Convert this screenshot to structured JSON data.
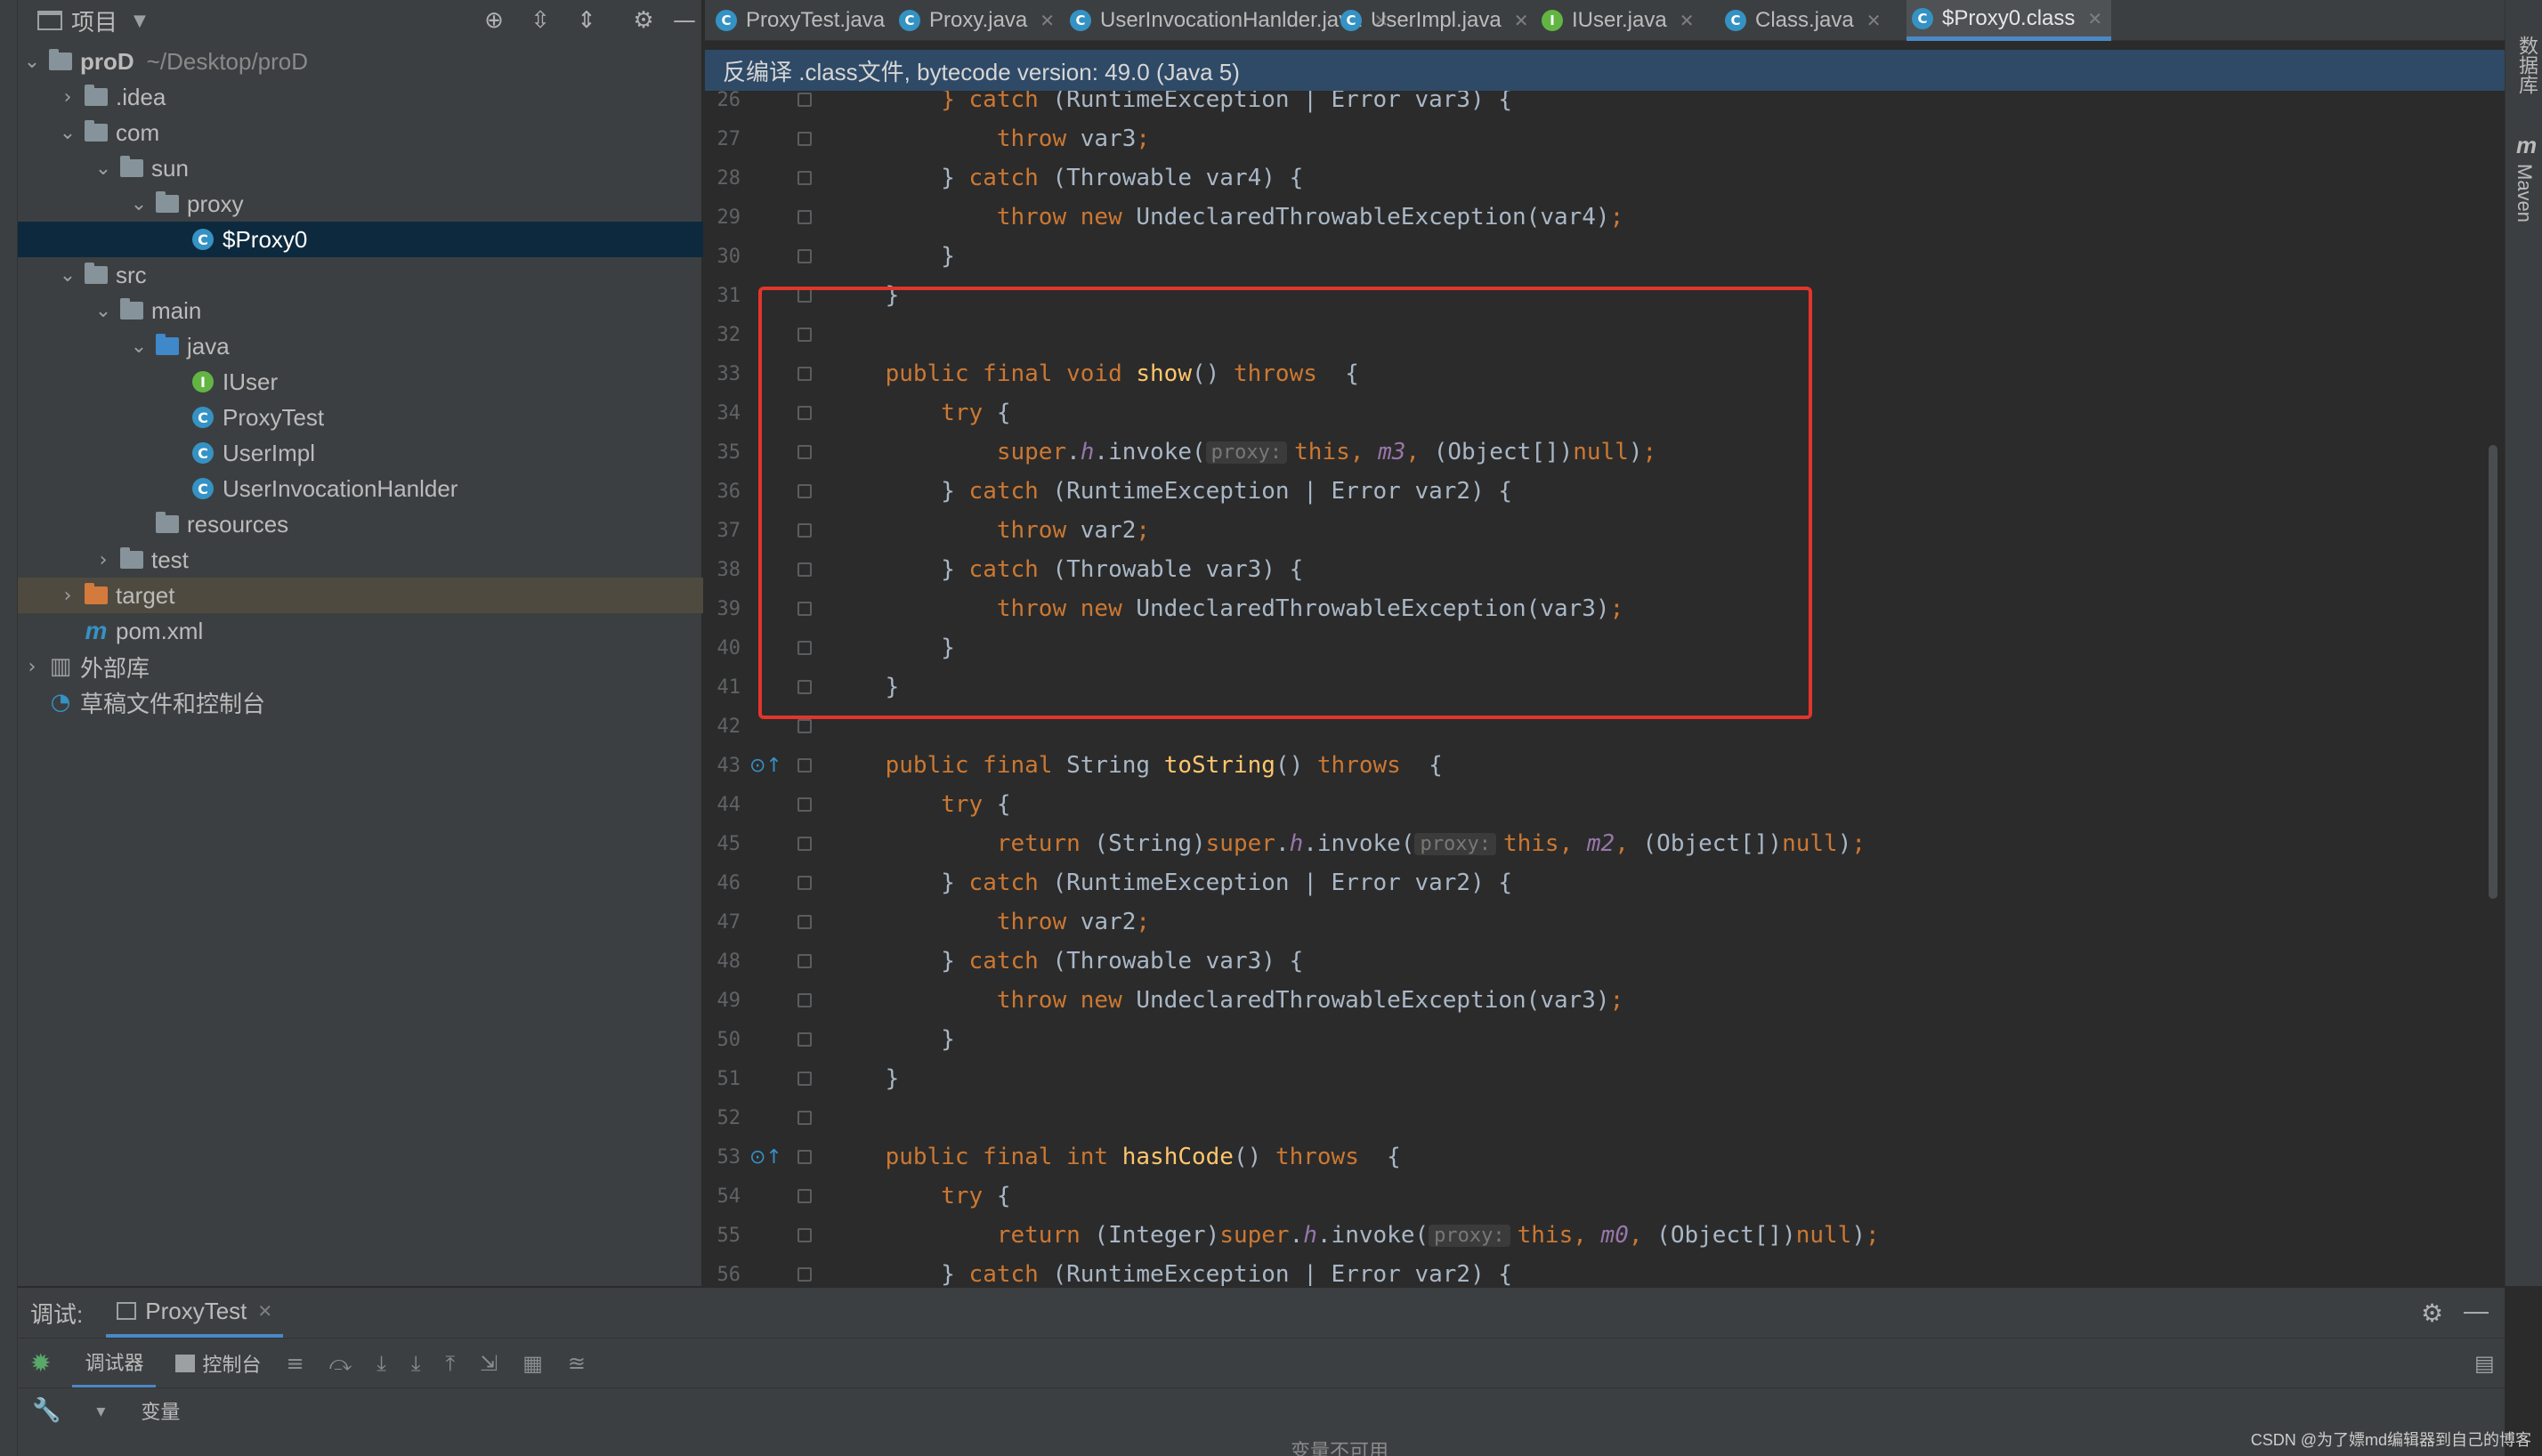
{
  "project": {
    "title": "项目",
    "tree": [
      {
        "label": "proD",
        "extra": "~/Desktop/proD",
        "depth": 0,
        "arrow": "down",
        "icon": "folder",
        "bold": true
      },
      {
        "label": ".idea",
        "depth": 1,
        "arrow": "right",
        "icon": "folder"
      },
      {
        "label": "com",
        "depth": 1,
        "arrow": "down",
        "icon": "folder"
      },
      {
        "label": "sun",
        "depth": 2,
        "arrow": "down",
        "icon": "folder"
      },
      {
        "label": "proxy",
        "depth": 3,
        "arrow": "down",
        "icon": "folder"
      },
      {
        "label": "$Proxy0",
        "depth": 4,
        "arrow": "",
        "icon": "class",
        "selected": true
      },
      {
        "label": "src",
        "depth": 1,
        "arrow": "down",
        "icon": "folder"
      },
      {
        "label": "main",
        "depth": 2,
        "arrow": "down",
        "icon": "folder"
      },
      {
        "label": "java",
        "depth": 3,
        "arrow": "down",
        "icon": "folder-blue"
      },
      {
        "label": "IUser",
        "depth": 4,
        "arrow": "",
        "icon": "interface"
      },
      {
        "label": "ProxyTest",
        "depth": 4,
        "arrow": "",
        "icon": "class"
      },
      {
        "label": "UserImpl",
        "depth": 4,
        "arrow": "",
        "icon": "class"
      },
      {
        "label": "UserInvocationHanlder",
        "depth": 4,
        "arrow": "",
        "icon": "class"
      },
      {
        "label": "resources",
        "depth": 3,
        "arrow": "",
        "icon": "folder-res"
      },
      {
        "label": "test",
        "depth": 2,
        "arrow": "right",
        "icon": "folder"
      },
      {
        "label": "target",
        "depth": 1,
        "arrow": "right",
        "icon": "folder-orange",
        "highlight": true
      },
      {
        "label": "pom.xml",
        "depth": 1,
        "arrow": "",
        "icon": "maven"
      },
      {
        "label": "外部库",
        "depth": 0,
        "arrow": "right",
        "icon": "library"
      },
      {
        "label": "草稿文件和控制台",
        "depth": 0,
        "arrow": "",
        "icon": "scratch"
      }
    ]
  },
  "tabs": [
    {
      "label": "ProxyTest.java",
      "icon": "class"
    },
    {
      "label": "Proxy.java",
      "icon": "class"
    },
    {
      "label": "UserInvocationHanlder.java",
      "icon": "class"
    },
    {
      "label": "UserImpl.java",
      "icon": "class"
    },
    {
      "label": "IUser.java",
      "icon": "interface"
    },
    {
      "label": "Class.java",
      "icon": "class"
    },
    {
      "label": "$Proxy0.class",
      "icon": "class",
      "active": true
    }
  ],
  "banner": "反编译 .class文件, bytecode version: 49.0 (Java 5)",
  "code": [
    {
      "n": "26",
      "t": [
        [
          "kw",
          "        } catch "
        ],
        [
          "tx",
          "(RuntimeException | Error var3) {"
        ]
      ]
    },
    {
      "n": "27",
      "t": [
        [
          "kw",
          "            throw "
        ],
        [
          "tx",
          "var3"
        ],
        [
          "kw",
          ";"
        ]
      ]
    },
    {
      "n": "28",
      "t": [
        [
          "tx",
          "        } "
        ],
        [
          "kw",
          "catch "
        ],
        [
          "tx",
          "(Throwable var4) {"
        ]
      ]
    },
    {
      "n": "29",
      "t": [
        [
          "kw",
          "            throw new "
        ],
        [
          "tx",
          "UndeclaredThrowableException(var4)"
        ],
        [
          "kw",
          ";"
        ]
      ]
    },
    {
      "n": "30",
      "t": [
        [
          "tx",
          "        }"
        ]
      ]
    },
    {
      "n": "31",
      "t": [
        [
          "tx",
          "    }"
        ]
      ]
    },
    {
      "n": "32",
      "t": []
    },
    {
      "n": "33",
      "t": [
        [
          "kw",
          "    public final void "
        ],
        [
          "fn",
          "show"
        ],
        [
          "tx",
          "() "
        ],
        [
          "kw",
          "throws  "
        ],
        [
          "tx",
          "{"
        ]
      ]
    },
    {
      "n": "34",
      "t": [
        [
          "kw",
          "        try "
        ],
        [
          "tx",
          "{"
        ]
      ]
    },
    {
      "n": "35",
      "t": [
        [
          "kw",
          "            super"
        ],
        [
          "tx",
          "."
        ],
        [
          "it",
          "h"
        ],
        [
          "tx",
          ".invoke("
        ],
        [
          "hint",
          "proxy:"
        ],
        [
          "kw",
          "this, "
        ],
        [
          "it",
          "m3"
        ],
        [
          "kw",
          ", "
        ],
        [
          "tx",
          "(Object[])"
        ],
        [
          "kw",
          "null"
        ],
        [
          "tx",
          ")"
        ],
        [
          "kw",
          ";"
        ]
      ]
    },
    {
      "n": "36",
      "t": [
        [
          "tx",
          "        } "
        ],
        [
          "kw",
          "catch "
        ],
        [
          "tx",
          "(RuntimeException | Error var2) {"
        ]
      ]
    },
    {
      "n": "37",
      "t": [
        [
          "kw",
          "            throw "
        ],
        [
          "tx",
          "var2"
        ],
        [
          "kw",
          ";"
        ]
      ]
    },
    {
      "n": "38",
      "t": [
        [
          "tx",
          "        } "
        ],
        [
          "kw",
          "catch "
        ],
        [
          "tx",
          "(Throwable var3) {"
        ]
      ]
    },
    {
      "n": "39",
      "t": [
        [
          "kw",
          "            throw new "
        ],
        [
          "tx",
          "UndeclaredThrowableException(var3)"
        ],
        [
          "kw",
          ";"
        ]
      ]
    },
    {
      "n": "40",
      "t": [
        [
          "tx",
          "        }"
        ]
      ]
    },
    {
      "n": "41",
      "t": [
        [
          "tx",
          "    }"
        ]
      ]
    },
    {
      "n": "42",
      "t": []
    },
    {
      "n": "43",
      "t": [
        [
          "kw",
          "    public final "
        ],
        [
          "tx",
          "String "
        ],
        [
          "fn",
          "toString"
        ],
        [
          "tx",
          "() "
        ],
        [
          "kw",
          "throws  "
        ],
        [
          "tx",
          "{"
        ]
      ],
      "marker": true
    },
    {
      "n": "44",
      "t": [
        [
          "kw",
          "        try "
        ],
        [
          "tx",
          "{"
        ]
      ]
    },
    {
      "n": "45",
      "t": [
        [
          "kw",
          "            return "
        ],
        [
          "tx",
          "(String)"
        ],
        [
          "kw",
          "super"
        ],
        [
          "tx",
          "."
        ],
        [
          "it",
          "h"
        ],
        [
          "tx",
          ".invoke("
        ],
        [
          "hint",
          "proxy:"
        ],
        [
          "kw",
          "this, "
        ],
        [
          "it",
          "m2"
        ],
        [
          "kw",
          ", "
        ],
        [
          "tx",
          "(Object[])"
        ],
        [
          "kw",
          "null"
        ],
        [
          "tx",
          ")"
        ],
        [
          "kw",
          ";"
        ]
      ]
    },
    {
      "n": "46",
      "t": [
        [
          "tx",
          "        } "
        ],
        [
          "kw",
          "catch "
        ],
        [
          "tx",
          "(RuntimeException | Error var2) {"
        ]
      ]
    },
    {
      "n": "47",
      "t": [
        [
          "kw",
          "            throw "
        ],
        [
          "tx",
          "var2"
        ],
        [
          "kw",
          ";"
        ]
      ]
    },
    {
      "n": "48",
      "t": [
        [
          "tx",
          "        } "
        ],
        [
          "kw",
          "catch "
        ],
        [
          "tx",
          "(Throwable var3) {"
        ]
      ]
    },
    {
      "n": "49",
      "t": [
        [
          "kw",
          "            throw new "
        ],
        [
          "tx",
          "UndeclaredThrowableException(var3)"
        ],
        [
          "kw",
          ";"
        ]
      ]
    },
    {
      "n": "50",
      "t": [
        [
          "tx",
          "        }"
        ]
      ]
    },
    {
      "n": "51",
      "t": [
        [
          "tx",
          "    }"
        ]
      ]
    },
    {
      "n": "52",
      "t": []
    },
    {
      "n": "53",
      "t": [
        [
          "kw",
          "    public final int "
        ],
        [
          "fn",
          "hashCode"
        ],
        [
          "tx",
          "() "
        ],
        [
          "kw",
          "throws  "
        ],
        [
          "tx",
          "{"
        ]
      ],
      "marker": true
    },
    {
      "n": "54",
      "t": [
        [
          "kw",
          "        try "
        ],
        [
          "tx",
          "{"
        ]
      ]
    },
    {
      "n": "55",
      "t": [
        [
          "kw",
          "            return "
        ],
        [
          "tx",
          "(Integer)"
        ],
        [
          "kw",
          "super"
        ],
        [
          "tx",
          "."
        ],
        [
          "it",
          "h"
        ],
        [
          "tx",
          ".invoke("
        ],
        [
          "hint",
          "proxy:"
        ],
        [
          "kw",
          "this, "
        ],
        [
          "it",
          "m0"
        ],
        [
          "kw",
          ", "
        ],
        [
          "tx",
          "(Object[])"
        ],
        [
          "kw",
          "null"
        ],
        [
          "tx",
          ")"
        ],
        [
          "kw",
          ";"
        ]
      ]
    },
    {
      "n": "56",
      "t": [
        [
          "tx",
          "        } "
        ],
        [
          "kw",
          "catch "
        ],
        [
          "tx",
          "(RuntimeException | Error var2) {"
        ]
      ]
    }
  ],
  "right_strip": {
    "database": "数据库",
    "maven": "Maven",
    "maven_letter": "m"
  },
  "debug": {
    "label": "调试:",
    "session_tab": "ProxyTest",
    "debugger_tab": "调试器",
    "console_tab": "控制台",
    "variables": "变量",
    "unavailable": "变量不可用"
  },
  "watermark": "CSDN @为了嫖md编辑器到自己的博客"
}
